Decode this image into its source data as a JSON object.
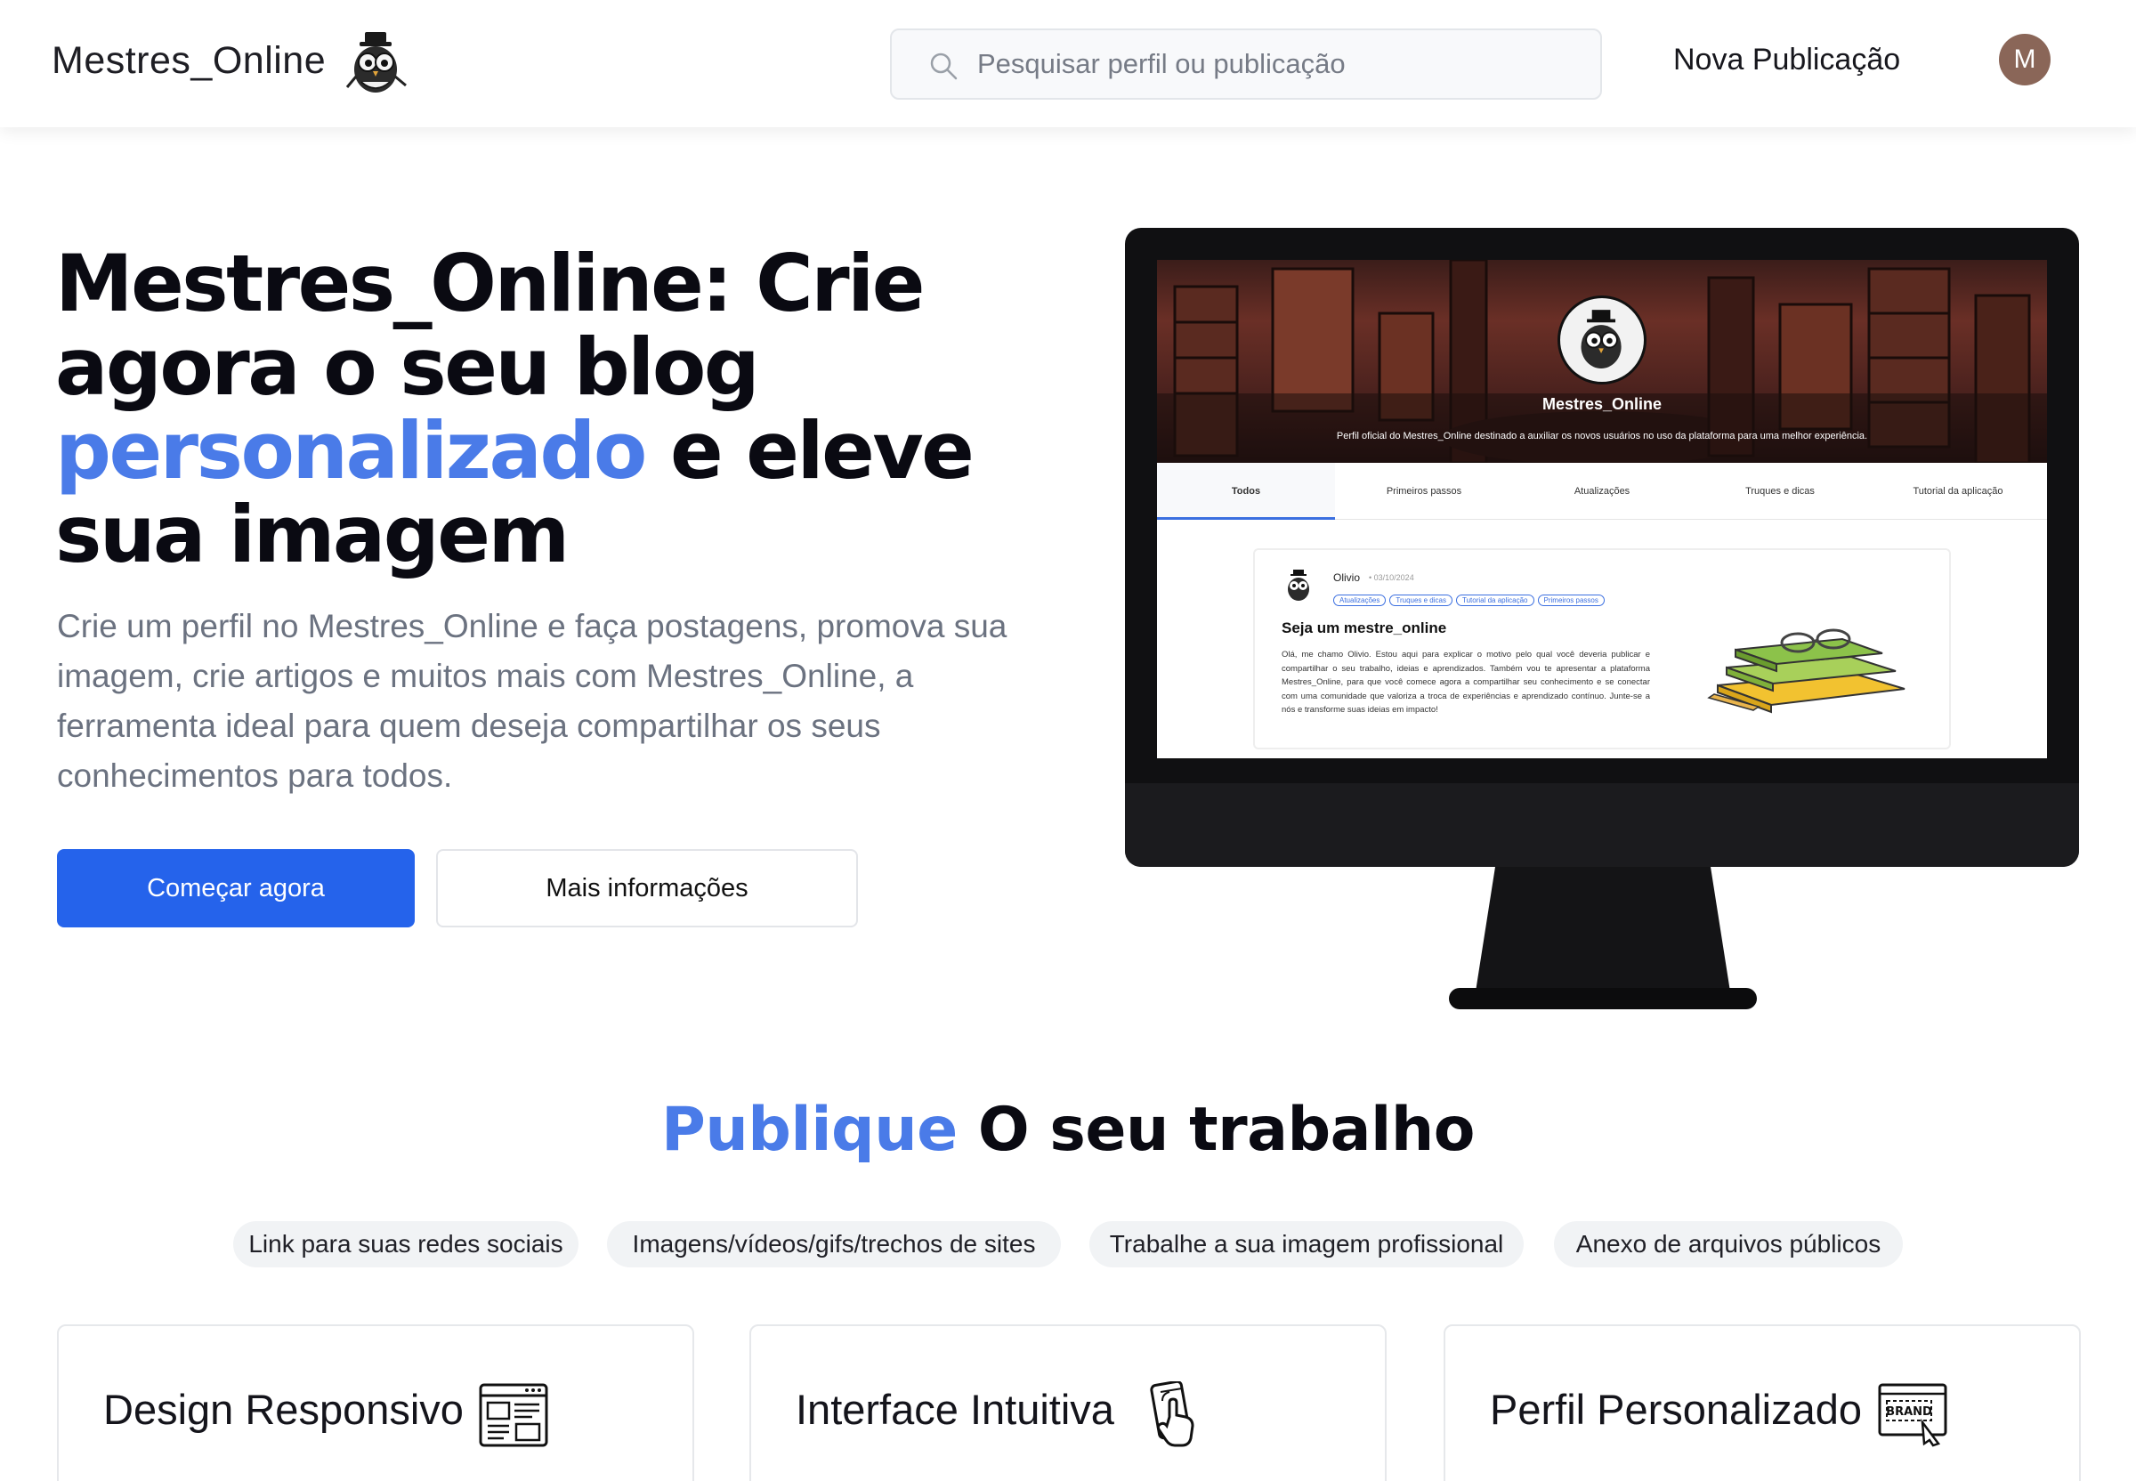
{
  "navbar": {
    "logo_text": "Mestres_Online",
    "search_placeholder": "Pesquisar perfil ou publicação",
    "new_post_label": "Nova Publicação",
    "avatar_initial": "M"
  },
  "hero": {
    "title_part1": "Mestres_Online: Crie agora o seu blog ",
    "title_accent": "personalizado",
    "title_part2": " e eleve sua imagem",
    "description": "Crie um perfil no Mestres_Online e faça postagens, promova sua imagem, crie artigos e muitos mais com Mestres_Online, a ferramenta ideal para quem deseja compartilhar os seus conhecimentos para todos.",
    "primary_button": "Começar agora",
    "secondary_button": "Mais informações"
  },
  "preview": {
    "profile_name": "Mestres_Online",
    "profile_bio": "Perfil oficial do Mestres_Online destinado a auxiliar os novos usuários no uso da plataforma para uma melhor experiência.",
    "tabs": [
      "Todos",
      "Primeiros passos",
      "Atualizações",
      "Truques e dicas",
      "Tutorial da aplicação"
    ],
    "post": {
      "author": "Olivio",
      "date": "• 03/10/2024",
      "tags": [
        "Atualizações",
        "Truques e dicas",
        "Tutorial da aplicação",
        "Primeiros passos"
      ],
      "title": "Seja um mestre_online",
      "body": "Olá, me chamo Olivio. Estou aqui para explicar o motivo pelo qual você deveria publicar e compartilhar o seu trabalho, ideias e aprendizados. Também vou te apresentar a plataforma Mestres_Online, para que você comece agora a compartilhar seu conhecimento e se conectar com uma comunidade que valoriza a troca de experiências e aprendizado contínuo. Junte-se a nós e transforme suas ideias em impacto!"
    }
  },
  "section": {
    "title_accent": "Publique",
    "title_rest": " O seu trabalho",
    "chips": [
      "Link para suas redes sociais",
      "Imagens/vídeos/gifs/trechos de sites",
      "Trabalhe a sua imagem profissional",
      "Anexo de arquivos públicos"
    ],
    "cards": [
      {
        "title": "Design Responsivo",
        "icon": "layout-icon"
      },
      {
        "title": "Interface Intuitiva",
        "icon": "touch-phone-icon"
      },
      {
        "title": "Perfil Personalizado",
        "icon": "brand-board-icon"
      }
    ]
  },
  "colors": {
    "accent": "#4a7be8",
    "primary_button": "#2563eb",
    "avatar_bg": "#8a6658"
  }
}
